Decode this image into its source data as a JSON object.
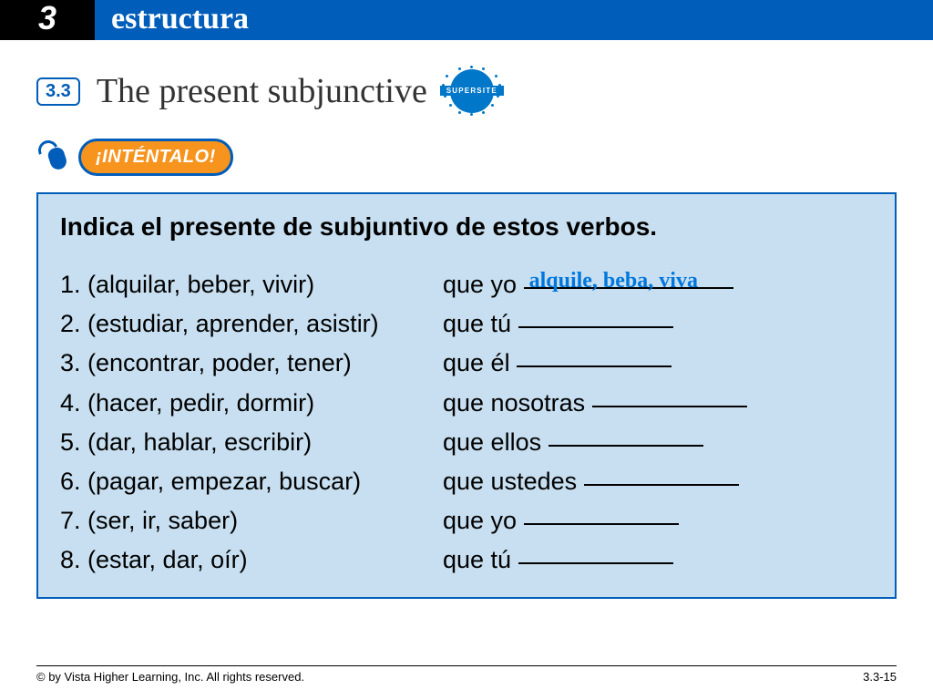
{
  "header": {
    "chapter": "3",
    "title": "estructura"
  },
  "section": {
    "number": "3.3",
    "title": "The present subjunctive",
    "supersite": "SUPERSITE"
  },
  "try_badge": "¡INTÉNTALO!",
  "exercise": {
    "instruction": "Indica el presente de subjuntivo de estos verbos.",
    "items": [
      {
        "num": "1.",
        "verbs": "(alquilar, beber, vivir)",
        "prompt": "que yo ",
        "answer": "alquile, beba, viva",
        "blank_width": 230
      },
      {
        "num": "2.",
        "verbs": "(estudiar, aprender, asistir)",
        "prompt": "que tú ",
        "answer": "",
        "blank_width": 170
      },
      {
        "num": "3.",
        "verbs": "(encontrar, poder, tener)",
        "prompt": "que él ",
        "answer": "",
        "blank_width": 170
      },
      {
        "num": "4.",
        "verbs": "(hacer, pedir, dormir)",
        "prompt": "que nosotras ",
        "answer": "",
        "blank_width": 170
      },
      {
        "num": "5.",
        "verbs": "(dar, hablar, escribir)",
        "prompt": "que ellos ",
        "answer": "",
        "blank_width": 170
      },
      {
        "num": "6.",
        "verbs": "(pagar, empezar, buscar)",
        "prompt": "que ustedes ",
        "answer": "",
        "blank_width": 170
      },
      {
        "num": "7.",
        "verbs": "(ser, ir, saber)",
        "prompt": "que yo ",
        "answer": "",
        "blank_width": 170
      },
      {
        "num": "8.",
        "verbs": "(estar, dar, oír)",
        "prompt": "que tú ",
        "answer": "",
        "blank_width": 170
      }
    ]
  },
  "footer": {
    "copyright": "© by Vista Higher Learning, Inc. All rights reserved.",
    "page": "3.3-15"
  }
}
